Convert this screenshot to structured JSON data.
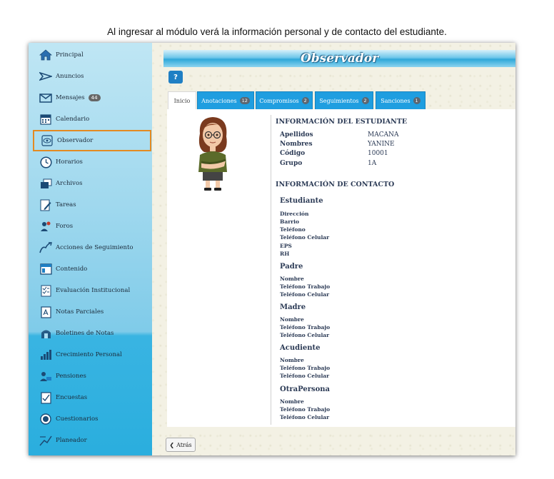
{
  "caption": "Al ingresar al módulo verá la información personal y de contacto del estudiante.",
  "sidebar": {
    "items": [
      {
        "label": "Principal",
        "icon": "home-icon"
      },
      {
        "label": "Anuncios",
        "icon": "megaphone-icon"
      },
      {
        "label": "Mensajes",
        "icon": "envelope-icon",
        "badge": "44"
      },
      {
        "label": "Calendario",
        "icon": "calendar-icon"
      },
      {
        "label": "Observador",
        "icon": "eye-icon",
        "active": true
      },
      {
        "label": "Horarios",
        "icon": "clock-icon"
      },
      {
        "label": "Archivos",
        "icon": "folders-icon"
      },
      {
        "label": "Tareas",
        "icon": "pencil-icon"
      },
      {
        "label": "Foros",
        "icon": "forum-icon"
      },
      {
        "label": "Acciones de Seguimiento",
        "icon": "follow-up-icon"
      },
      {
        "label": "Contenido",
        "icon": "content-icon"
      },
      {
        "label": "Evaluación Institucional",
        "icon": "evaluation-icon"
      },
      {
        "label": "Notas Parciales",
        "icon": "grades-icon"
      },
      {
        "label": "Boletines de Notas",
        "icon": "report-icon"
      },
      {
        "label": "Crecimiento Personal",
        "icon": "growth-chart-icon"
      },
      {
        "label": "Pensiones",
        "icon": "payment-icon"
      },
      {
        "label": "Encuestas",
        "icon": "survey-icon"
      },
      {
        "label": "Cuestionarios",
        "icon": "quiz-icon"
      },
      {
        "label": "Planeador",
        "icon": "planner-icon"
      }
    ]
  },
  "header": {
    "title": "Observador",
    "help_label": "?"
  },
  "tabs": [
    {
      "label": "Inicio",
      "count": ""
    },
    {
      "label": "Anotaciones",
      "count": "12"
    },
    {
      "label": "Compromisos",
      "count": "2"
    },
    {
      "label": "Seguimientos",
      "count": "2"
    },
    {
      "label": "Sanciones",
      "count": "1"
    }
  ],
  "student_info": {
    "title": "INFORMACIÓN DEL ESTUDIANTE",
    "fields": [
      {
        "label": "Apellidos",
        "value": "MACANA"
      },
      {
        "label": "Nombres",
        "value": "YANINE"
      },
      {
        "label": "Código",
        "value": "10001"
      },
      {
        "label": "Grupo",
        "value": "1A"
      }
    ]
  },
  "contact_info": {
    "title": "INFORMACIÓN DE CONTACTO",
    "groups": [
      {
        "title": "Estudiante",
        "fields": [
          "Dirección",
          "Barrio",
          "Teléfono",
          "Teléfono Celular",
          "EPS",
          "RH"
        ]
      },
      {
        "title": "Padre",
        "fields": [
          "Nombre",
          "Teléfono Trabajo",
          "Teléfono Celular"
        ]
      },
      {
        "title": "Madre",
        "fields": [
          "Nombre",
          "Teléfono Trabajo",
          "Teléfono Celular"
        ]
      },
      {
        "title": "Acudiente",
        "fields": [
          "Nombre",
          "Teléfono Trabajo",
          "Teléfono Celular"
        ]
      },
      {
        "title": "OtraPersona",
        "fields": [
          "Nombre",
          "Teléfono Trabajo",
          "Teléfono Celular"
        ]
      }
    ]
  },
  "footer": {
    "back_label": "Atrás"
  },
  "colors": {
    "accent": "#1f9ee0",
    "active_outline": "#e38a22",
    "text": "#2b3a55"
  }
}
